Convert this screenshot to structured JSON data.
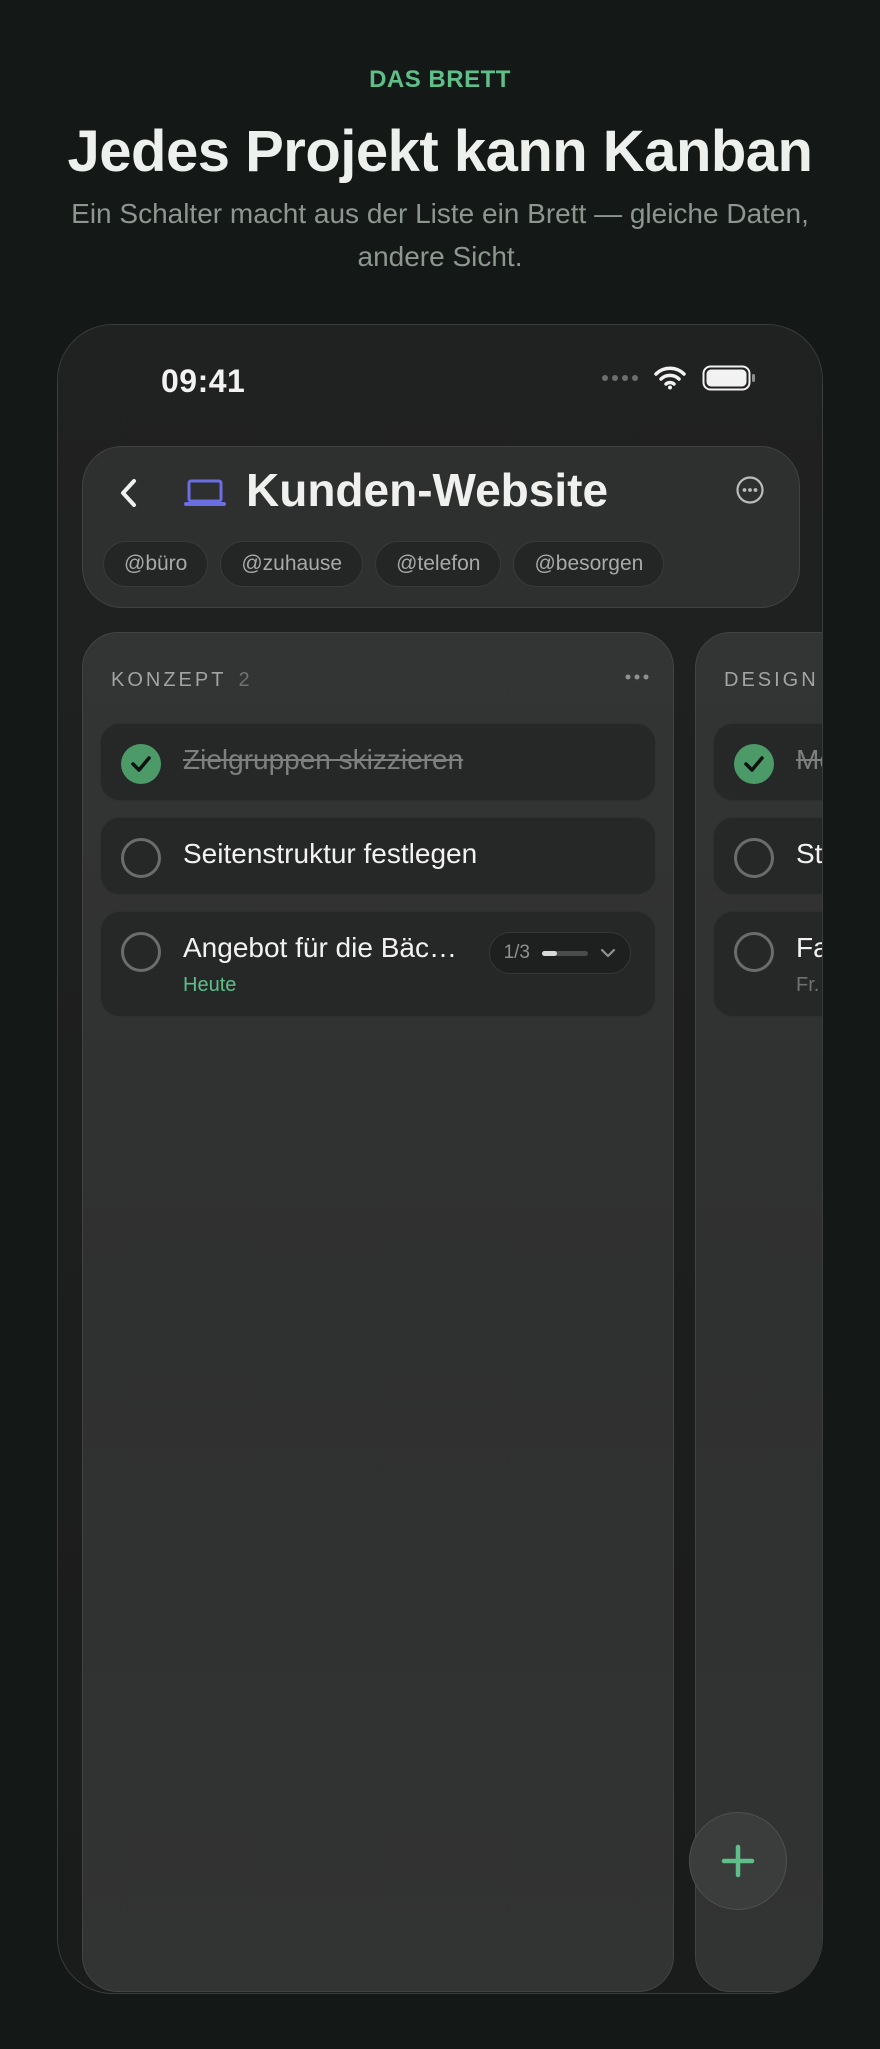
{
  "section": {
    "eyebrow": "DAS BRETT",
    "headline": "Jedes Projekt kann Kanban",
    "subtitle": "Ein Schalter macht aus der Liste ein Brett — gleiche Daten, andere Sicht."
  },
  "status_bar": {
    "time": "09:41",
    "icons": [
      "signal-dots-icon",
      "wifi-icon",
      "battery-icon"
    ]
  },
  "header": {
    "title": "Kunden-Website",
    "project_icon": "laptop-icon",
    "project_icon_color": "#6a6ee0",
    "tags": [
      "@büro",
      "@zuhause",
      "@telefon",
      "@besorgen"
    ]
  },
  "columns": [
    {
      "title": "KONZEPT",
      "count": "2",
      "cards": [
        {
          "text": "Zielgruppen skizzieren",
          "done": true
        },
        {
          "text": "Seitenstruktur festlegen",
          "done": false
        },
        {
          "text": "Angebot für die Bäc…",
          "done": false,
          "date": "Heute",
          "subtasks": "1/3",
          "subtask_progress": 0.33
        }
      ]
    },
    {
      "title": "DESIGN",
      "cards": [
        {
          "text": "Mo",
          "done": true
        },
        {
          "text": "St",
          "done": false
        },
        {
          "text": "Fa",
          "done": false,
          "date": "Fr."
        }
      ]
    }
  ],
  "colors": {
    "accent": "#5fbf88",
    "done": "#4c9a68",
    "background": "#141817"
  }
}
